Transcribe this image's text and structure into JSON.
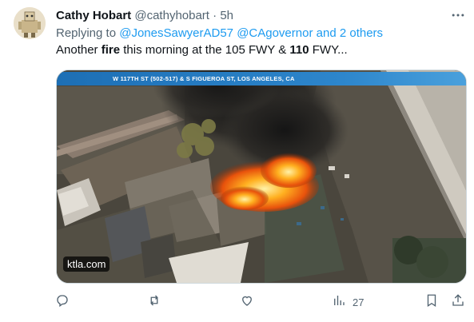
{
  "tweet": {
    "author_name": "Cathy Hobart",
    "handle": "@cathyhobart",
    "separator": "·",
    "time": "5h",
    "replying_prefix": "Replying to",
    "replying_user1": "@JonesSawyerAD57",
    "replying_user2": "@CAgovernor",
    "replying_and": "and",
    "replying_others": "2 others",
    "text_part1": "Another ",
    "text_bold1": "fire",
    "text_part2": " this morning at the 105 FWY & ",
    "text_bold2": "110",
    "text_part3": " FWY..."
  },
  "media": {
    "banner": "W 117TH ST (502-517) & S FIGUEROA ST, LOS ANGELES, CA",
    "watermark": "ktla.com"
  },
  "actions": {
    "views_count": "27"
  },
  "icons": {
    "reply": "reply-icon",
    "retweet": "retweet-icon",
    "like": "like-icon",
    "views": "views-icon",
    "bookmark": "bookmark-icon",
    "share": "share-icon",
    "more": "more-icon"
  },
  "colors": {
    "accent": "#1d9bf0",
    "secondary_text": "#536471"
  }
}
